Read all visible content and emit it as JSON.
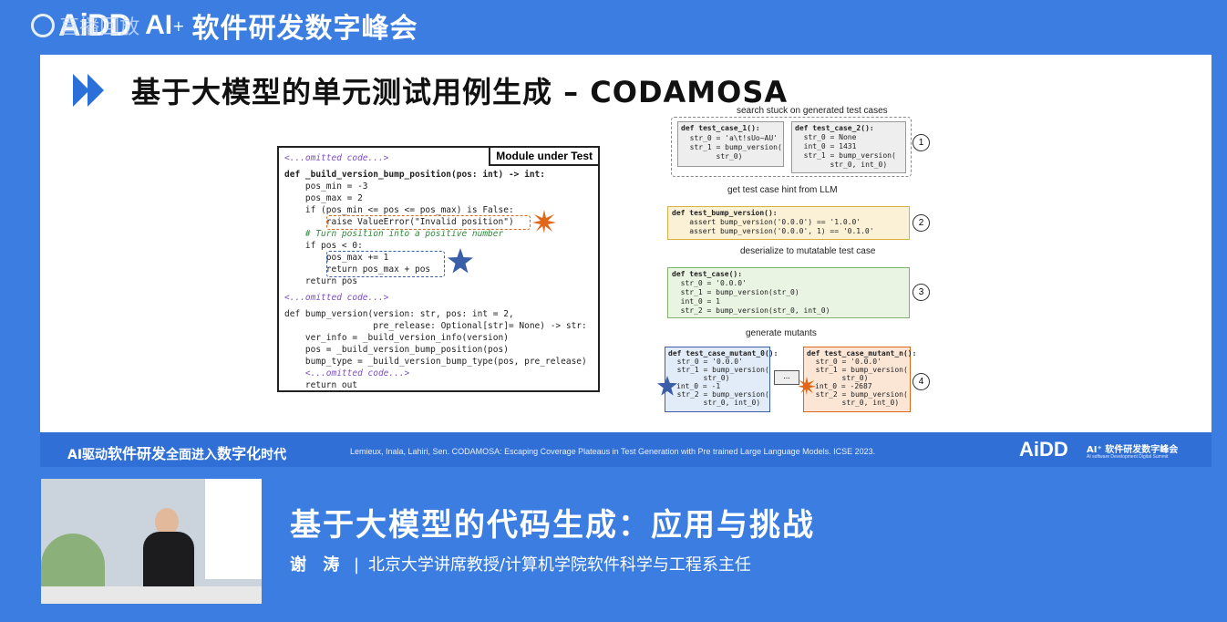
{
  "header": {
    "replay_label": "直播回放",
    "logo_mark": "AiDD",
    "logo_ai": "AI",
    "logo_sup": "+",
    "event_name": "软件研发数字峰会"
  },
  "slide": {
    "title": "基于大模型的单元测试用例生成 – CODAMOSA",
    "module_label": "Module under Test",
    "code_lines": [
      "<...omitted code...>",
      "def _build_version_bump_position(pos: int) -> int:",
      "    pos_min = -3",
      "    pos_max = 2",
      "    if (pos_min <= pos <= pos_max) is False:",
      "        raise ValueError(\"Invalid position\")",
      "    # Turn position into a positive number",
      "    if pos < 0:",
      "        pos_max += 1",
      "        return pos_max + pos",
      "    return pos",
      "<...omitted code...>",
      "def bump_version(version: str, pos: int = 2,",
      "                 pre_release: Optional[str]= None) -> str:",
      "    ver_info = _build_version_info(version)",
      "    pos = _build_version_bump_position(pos)",
      "    bump_type = _build_version_bump_type(pos, pre_release)",
      "    <...omitted code...>",
      "    return out"
    ],
    "flow": {
      "stuck_label": "search stuck on generated test cases",
      "case1": [
        "def test_case_1():",
        "  str_0 = 'a\\t!sUo~AU'",
        "  str_1 = bump_version(",
        "        str_0)"
      ],
      "case2": [
        "def test_case_2():",
        "  str_0 = None",
        "  int_0 = 1431",
        "  str_1 = bump_version(",
        "        str_0, int_0)"
      ],
      "hint_label": "get test case hint from LLM",
      "llm_case": [
        "def test_bump_version():",
        "    assert bump_version('0.0.0') == '1.0.0'",
        "    assert bump_version('0.0.0', 1) == '0.1.0'"
      ],
      "deserialize_label": "deserialize to mutatable test case",
      "mut_case": [
        "def test_case():",
        "  str_0 = '0.0.0'",
        "  str_1 = bump_version(str_0)",
        "  int_0 = 1",
        "  str_2 = bump_version(str_0, int_0)"
      ],
      "mutants_label": "generate mutants",
      "mutant0": [
        "def test_case_mutant_0():",
        "  str_0 = '0.0.0'",
        "  str_1 = bump_version(",
        "        str_0)",
        "int_0 = -1",
        "  str_2 = bump_version(",
        "        str_0, int_0)"
      ],
      "mutantn": [
        "def test_case_mutant_n():",
        "  str_0 = '0.0.0'",
        "  str_1 = bump_version(",
        "        str_0)",
        "int_0 = -2687",
        "  str_2 = bump_version(",
        "        str_0, int_0)"
      ],
      "ellipsis": "...",
      "steps": [
        "1",
        "2",
        "3",
        "4"
      ]
    },
    "bar": {
      "tagline_a": "AI驱动",
      "tagline_b": "软件研发",
      "tagline_c": "全面进入",
      "tagline_d": "数字化",
      "tagline_e": "时代",
      "reference": "Lemieux, Inala, Lahiri, Sen. CODAMOSA: Escaping Coverage Plateaus in Test Generation with Pre trained Large Language Models. ICSE 2023.",
      "logo": "AiDD",
      "logo_sub": "AI⁺ 软件研发数字峰会",
      "logo_sub2": "AI software Development Digital Summit"
    }
  },
  "talk": {
    "title": "基于大模型的代码生成：应用与挑战",
    "speaker_name": "谢 涛",
    "speaker_title": "北京大学讲席教授/计算机学院软件科学与工程系主任"
  },
  "colors": {
    "background": "#3b7de0",
    "bar": "#2f6fd6",
    "title_arrow": "#2b6fd8",
    "star_orange": "#e0661a",
    "star_blue": "#3a5fa8"
  }
}
